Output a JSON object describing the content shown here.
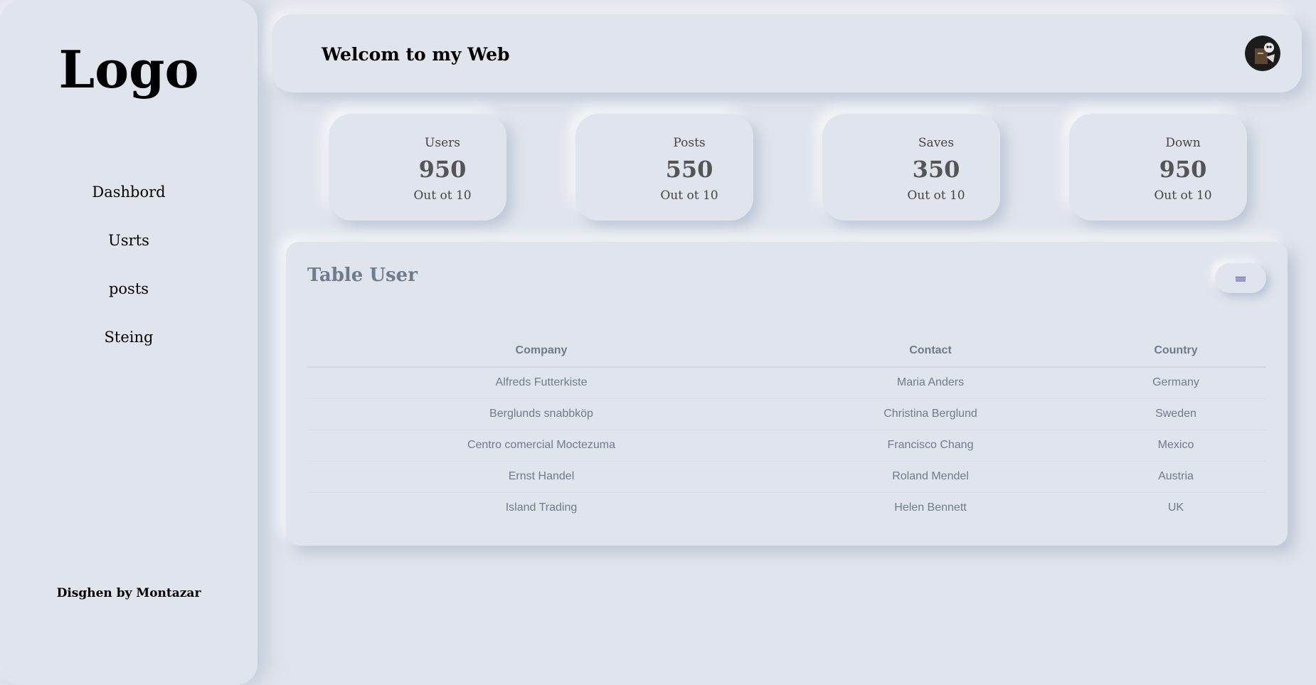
{
  "sidebar": {
    "logo": "Logo",
    "items": [
      {
        "label": "Dashbord"
      },
      {
        "label": "Usrts"
      },
      {
        "label": "posts"
      },
      {
        "label": "Steing"
      }
    ],
    "footer": "Disghen by Montazar"
  },
  "header": {
    "title": "Welcom to my Web",
    "avatar_icon": "avatar-photo"
  },
  "stats": [
    {
      "label": "Users",
      "value": "950",
      "sub": "Out ot 10"
    },
    {
      "label": "Posts",
      "value": "550",
      "sub": "Out ot 10"
    },
    {
      "label": "Saves",
      "value": "350",
      "sub": "Out ot 10"
    },
    {
      "label": "Down",
      "value": "950",
      "sub": "Out ot 10"
    }
  ],
  "table": {
    "title": "Table User",
    "menu_icon": "hamburger-icon",
    "menu_color": "#6a5acd",
    "columns": [
      "Company",
      "Contact",
      "Country"
    ],
    "rows": [
      [
        "Alfreds Futterkiste",
        "Maria Anders",
        "Germany"
      ],
      [
        "Berglunds snabbköp",
        "Christina Berglund",
        "Sweden"
      ],
      [
        "Centro comercial Moctezuma",
        "Francisco Chang",
        "Mexico"
      ],
      [
        "Ernst Handel",
        "Roland Mendel",
        "Austria"
      ],
      [
        "Island Trading",
        "Helen Bennett",
        "UK"
      ]
    ]
  }
}
